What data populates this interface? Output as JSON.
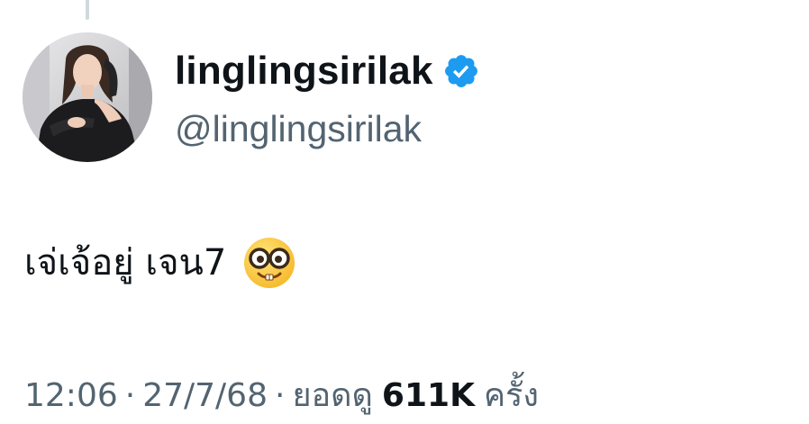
{
  "tweet": {
    "author": {
      "display_name": "linglingsirilak",
      "handle": "@linglingsirilak",
      "verified": true,
      "badge_color": "#1d9bf0"
    },
    "text": "เจ่เจ้อยู่ เจน7",
    "emoji": "nerd-face-emoji",
    "meta": {
      "time": "12:06",
      "separator": "·",
      "date": "27/7/68",
      "views_prefix": "ยอดดู",
      "views_count": "611K",
      "views_suffix": "ครั้ง"
    }
  },
  "colors": {
    "text_primary": "#0f1419",
    "text_secondary": "#536471",
    "thread_line": "#cfd9de"
  }
}
